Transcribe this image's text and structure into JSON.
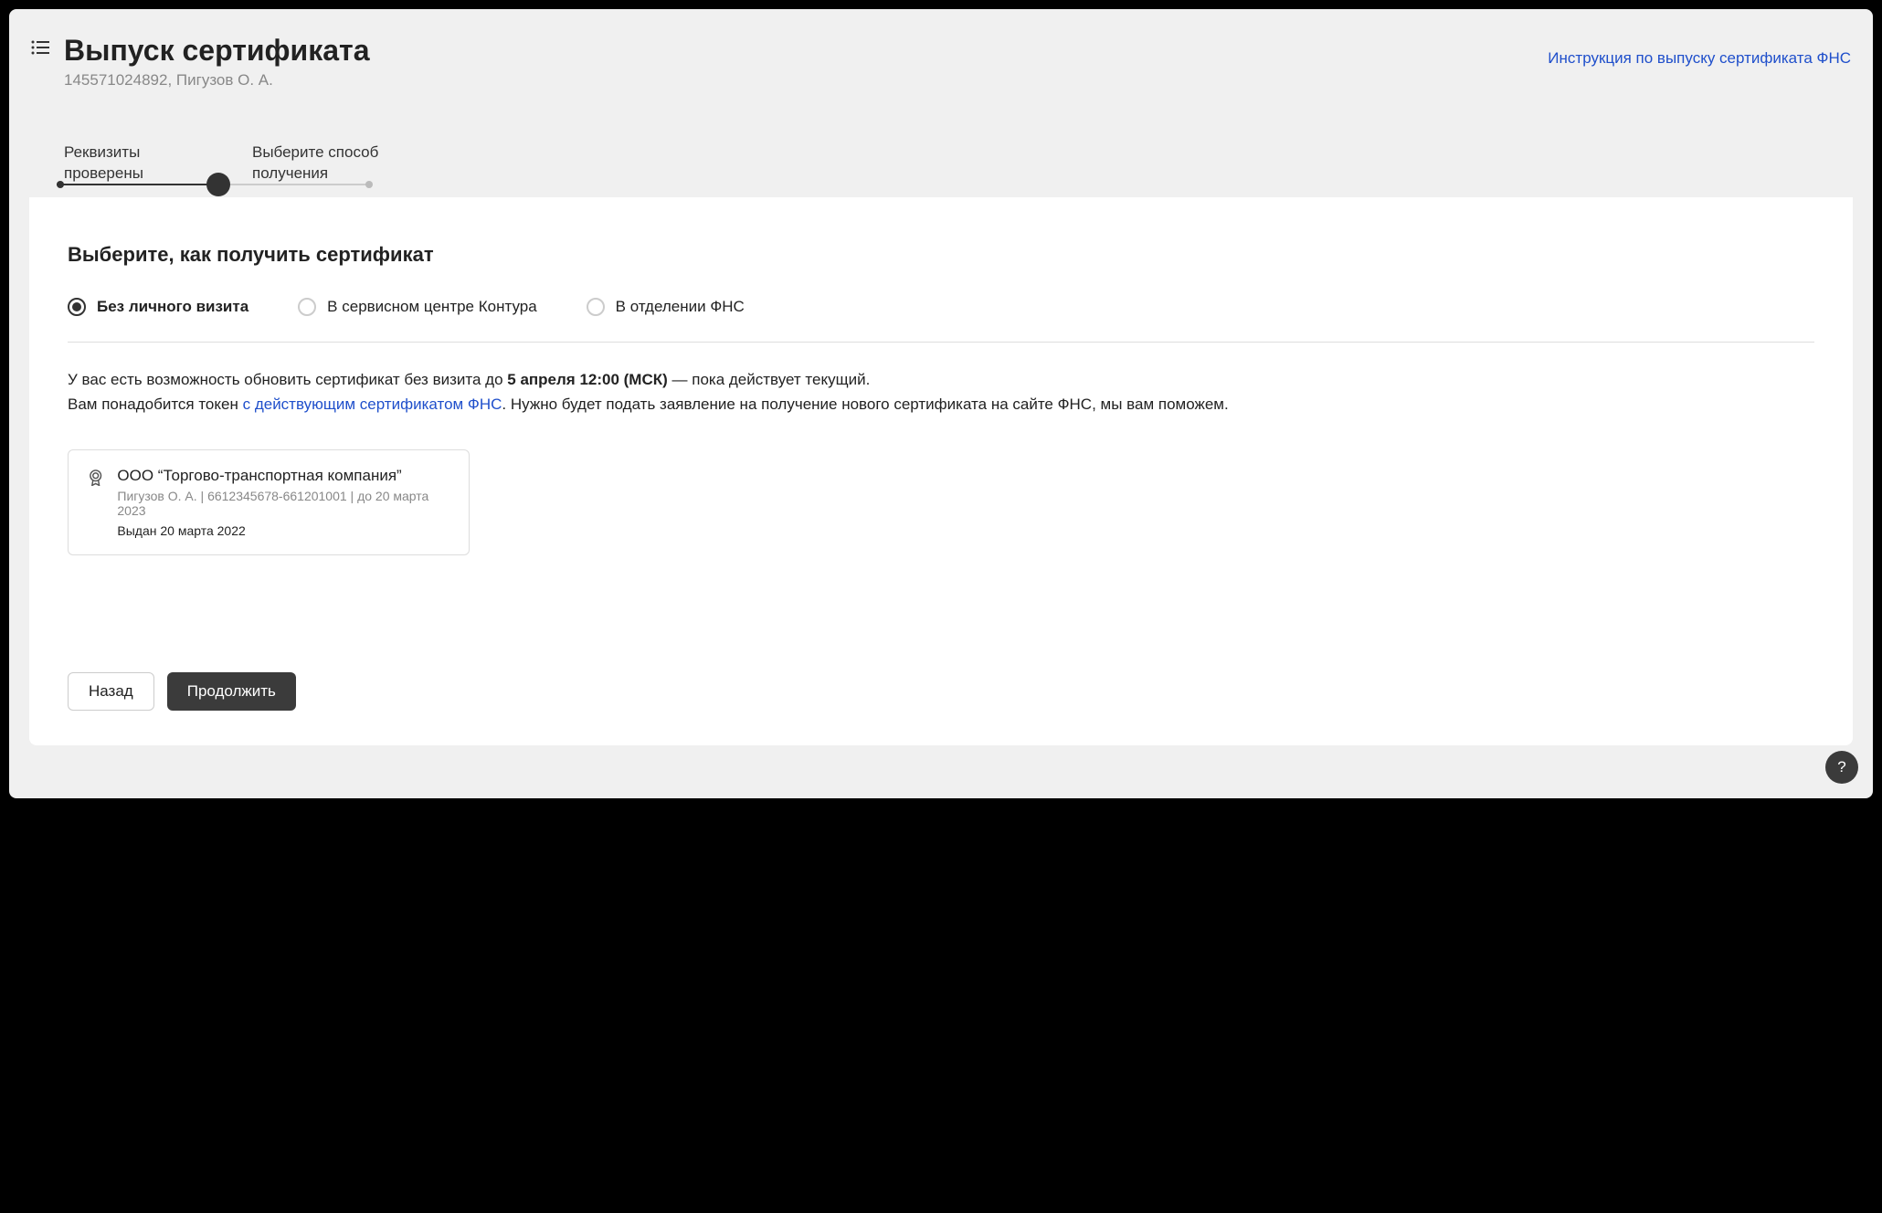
{
  "header": {
    "title": "Выпуск сертификата",
    "subtitle": "145571024892, Пигузов О. А.",
    "instruction_link": "Инструкция по выпуску сертификата ФНС"
  },
  "steps": {
    "step1": "Реквизиты проверены",
    "step2": "Выберите способ получения"
  },
  "main": {
    "heading": "Выберите, как получить сертификат",
    "radio_options": {
      "opt1": "Без личного визита",
      "opt2": "В сервисном центре Контура",
      "opt3": "В отделении ФНС"
    },
    "info": {
      "line1_pre": "У вас есть возможность обновить сертификат без визита до ",
      "line1_strong": "5 апреля 12:00 (МСК)",
      "line1_post": " — пока действует текущий.",
      "line2_pre": "Вам понадобится токен ",
      "line2_link": "с действующим сертификатом ФНС",
      "line2_post": ".  Нужно будет подать заявление на получение нового сертификата на сайте ФНС, мы вам поможем."
    },
    "cert": {
      "company": "ООО “Торгово-транспортная компания”",
      "meta": "Пигузов О. А. | 6612345678-661201001 | до 20 марта 2023",
      "issued": "Выдан 20 марта 2022"
    },
    "buttons": {
      "back": "Назад",
      "continue": "Продолжить"
    },
    "help": "?"
  }
}
